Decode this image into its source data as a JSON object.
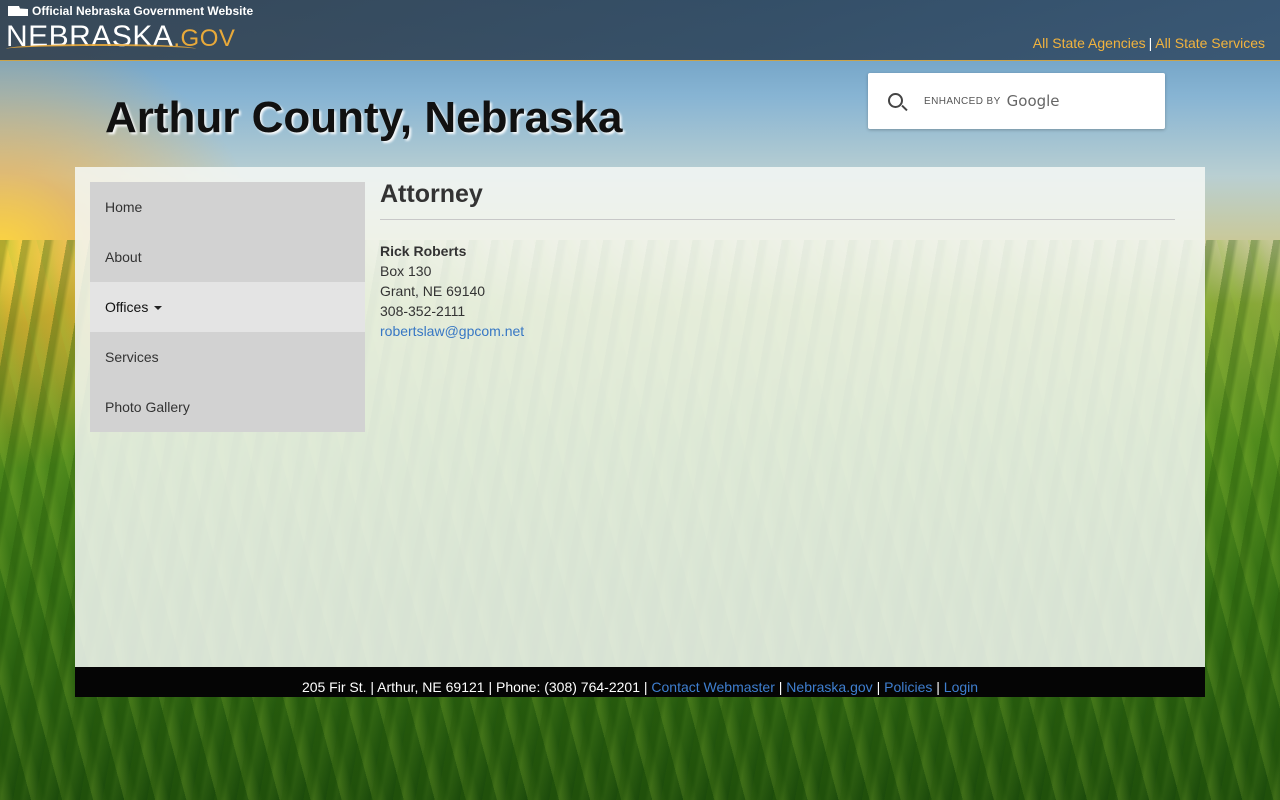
{
  "header": {
    "official_label": "Official Nebraska Government Website",
    "logo_main": "NEBRASKA",
    "logo_suffix": ".GOV",
    "links": [
      "All State Agencies",
      "All State Services"
    ],
    "separator": "|"
  },
  "site_title": "Arthur County, Nebraska",
  "search": {
    "placeholder": "",
    "enhanced_by": "ENHANCED BY",
    "provider": "Google"
  },
  "nav": {
    "items": [
      {
        "label": "Home"
      },
      {
        "label": "About"
      },
      {
        "label": "Offices",
        "active": true
      },
      {
        "label": "Services"
      },
      {
        "label": "Photo Gallery"
      }
    ]
  },
  "content": {
    "heading": "Attorney",
    "name": "Rick Roberts",
    "address1": "Box 130",
    "address2": "Grant, NE 69140",
    "phone": "308-352-2111",
    "email": "robertslaw@gpcom.net"
  },
  "footer": {
    "address": "205 Fir St. | Arthur, NE 69121 | Phone: (308) 764-2201 |",
    "links": [
      "Contact Webmaster",
      "Nebraska.gov",
      "Policies",
      "Login"
    ],
    "separator": "|"
  },
  "colors": {
    "accent_gold": "#f2b33d",
    "link_blue": "#3777c4"
  }
}
